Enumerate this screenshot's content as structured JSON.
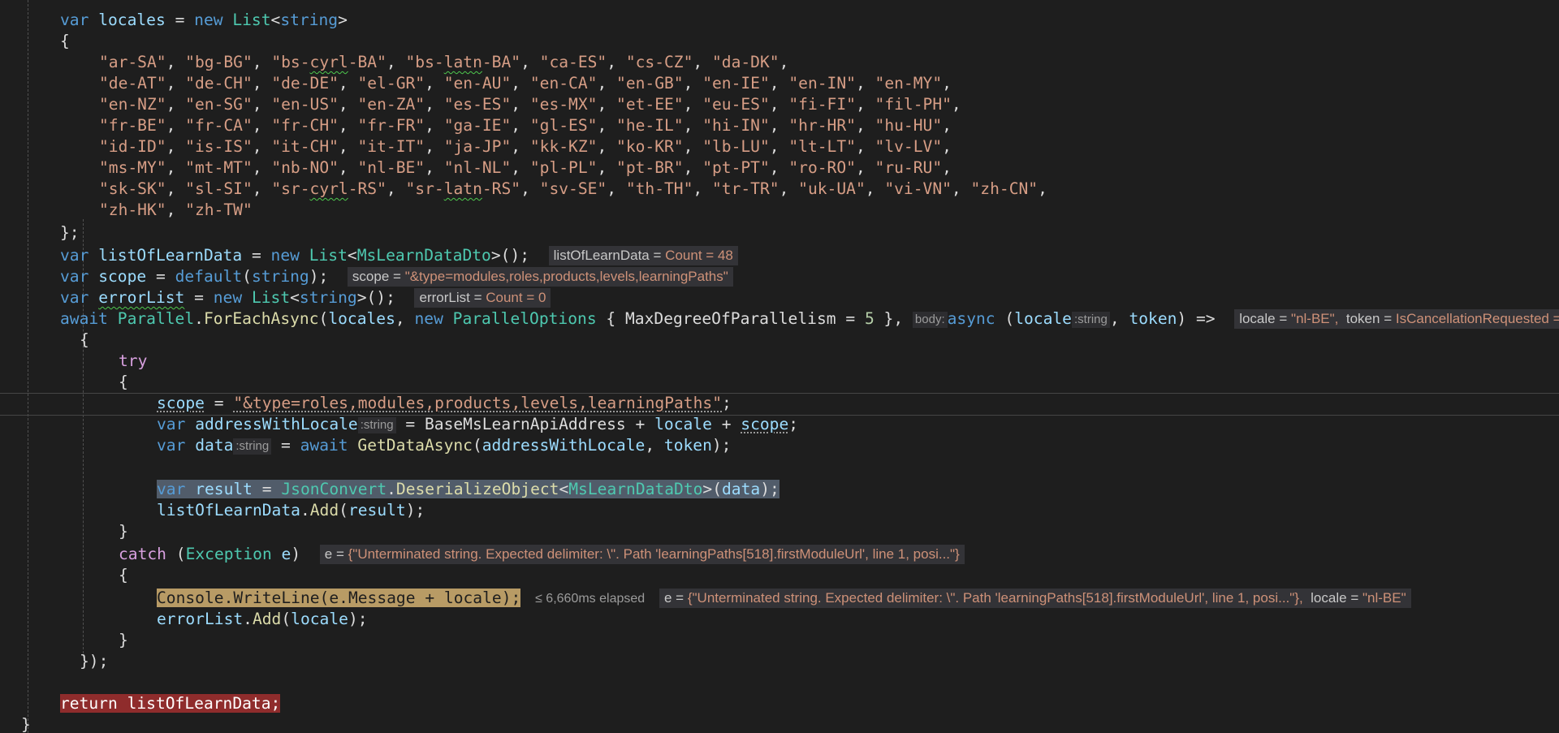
{
  "code": {
    "locales_decl": {
      "kw_var": "var",
      "name": "locales",
      "op": "=",
      "kw_new": "new",
      "type": "List",
      "generic_open": "<",
      "generic_type": "string",
      "generic_close": ">"
    },
    "open_brace": "{",
    "locale_rows": [
      [
        "\"ar-SA\"",
        "\"bg-BG\"",
        "\"bs-cyrl-BA\"",
        "\"bs-latn-BA\"",
        "\"ca-ES\"",
        "\"cs-CZ\"",
        "\"da-DK\""
      ],
      [
        "\"de-AT\"",
        "\"de-CH\"",
        "\"de-DE\"",
        "\"el-GR\"",
        "\"en-AU\"",
        "\"en-CA\"",
        "\"en-GB\"",
        "\"en-IE\"",
        "\"en-IN\"",
        "\"en-MY\""
      ],
      [
        "\"en-NZ\"",
        "\"en-SG\"",
        "\"en-US\"",
        "\"en-ZA\"",
        "\"es-ES\"",
        "\"es-MX\"",
        "\"et-EE\"",
        "\"eu-ES\"",
        "\"fi-FI\"",
        "\"fil-PH\""
      ],
      [
        "\"fr-BE\"",
        "\"fr-CA\"",
        "\"fr-CH\"",
        "\"fr-FR\"",
        "\"ga-IE\"",
        "\"gl-ES\"",
        "\"he-IL\"",
        "\"hi-IN\"",
        "\"hr-HR\"",
        "\"hu-HU\""
      ],
      [
        "\"id-ID\"",
        "\"is-IS\"",
        "\"it-CH\"",
        "\"it-IT\"",
        "\"ja-JP\"",
        "\"kk-KZ\"",
        "\"ko-KR\"",
        "\"lb-LU\"",
        "\"lt-LT\"",
        "\"lv-LV\""
      ],
      [
        "\"ms-MY\"",
        "\"mt-MT\"",
        "\"nb-NO\"",
        "\"nl-BE\"",
        "\"nl-NL\"",
        "\"pl-PL\"",
        "\"pt-BR\"",
        "\"pt-PT\"",
        "\"ro-RO\"",
        "\"ru-RU\""
      ],
      [
        "\"sk-SK\"",
        "\"sl-SI\"",
        "\"sr-cyrl-RS\"",
        "\"sr-latn-RS\"",
        "\"sv-SE\"",
        "\"th-TH\"",
        "\"tr-TR\"",
        "\"uk-UA\"",
        "\"vi-VN\"",
        "\"zh-CN\""
      ],
      [
        "\"zh-HK\"",
        "\"zh-TW\""
      ]
    ],
    "close_brace_semi": "};",
    "learn_decl": {
      "kw_var": "var",
      "name": "listOfLearnData",
      "op": "=",
      "kw_new": "new",
      "type": "List",
      "lt": "<",
      "generic_type": "MsLearnDataDto",
      "tail": ">();"
    },
    "learn_tip": {
      "name": "listOfLearnData",
      "eq": "=",
      "value": "Count = 48"
    },
    "scope_decl": {
      "kw_var": "var",
      "name": "scope",
      "op": "=",
      "kw_default": "default",
      "paren_open": "(",
      "kw_string": "string",
      "tail": ");"
    },
    "scope_tip": {
      "name": "scope",
      "eq": "=",
      "value": "\"&type=modules,roles,products,levels,learningPaths\""
    },
    "error_decl": {
      "kw_var": "var",
      "name": "errorList",
      "op": "=",
      "kw_new": "new",
      "type": "List",
      "generic_open": "<",
      "generic_type": "string",
      "tail": ">();"
    },
    "error_tip": {
      "name": "errorList",
      "eq": "=",
      "value": "Count = 0"
    },
    "await_line": {
      "kw_await": "await",
      "type_parallel": "Parallel",
      "dot": ".",
      "method": "ForEachAsync",
      "paren_open": "(",
      "arg_locales": "locales",
      "comma": ",",
      "kw_new": "new",
      "type_options": "ParallelOptions",
      "brace_open": "{",
      "prop": "MaxDegreeOfParallelism",
      "eq": "=",
      "num": "5",
      "brace_close": "},",
      "hint_body": "body:",
      "kw_async": "async",
      "paren2_open": "(",
      "param_locale": "locale",
      "hint_string": ":string",
      "comma2": ",",
      "param_token": "token",
      "arrow": ") =>"
    },
    "await_tip": {
      "locale_name": "locale",
      "eq": "=",
      "locale_value": "\"nl-BE\",",
      "token_name": "token",
      "token_value": "IsCancellationRequested = false"
    },
    "lambda_open": "{",
    "kw_try": "try",
    "try_open": "{",
    "scope_assign": {
      "name": "scope",
      "op": "=",
      "value": "\"&type=roles,modules,products,levels,learningPaths\"",
      "semi": ";"
    },
    "address_decl": {
      "kw_var": "var",
      "name": "addressWithLocale",
      "hint": ":string",
      "op": "=",
      "base": "BaseMsLearnApiAddress",
      "plus1": "+",
      "locale": "locale",
      "plus2": "+",
      "scope": "scope",
      "semi": ";"
    },
    "data_decl": {
      "kw_var": "var",
      "name": "data",
      "hint": ":string",
      "op": "=",
      "kw_await": "await",
      "method": "GetDataAsync",
      "paren": "(",
      "arg1": "addressWithLocale",
      "comma": ",",
      "arg2": "token",
      "tail": ");"
    },
    "result_decl": {
      "kw_var": "var",
      "name": "result",
      "op": "=",
      "type_json": "JsonConvert",
      "dot": ".",
      "method": "DeserializeObject",
      "lt": "<",
      "type_dto": "MsLearnDataDto",
      "gt_paren": ">(",
      "arg": "data",
      "tail": ");"
    },
    "add_result": {
      "list": "listOfLearnData",
      "dot": ".",
      "method": "Add",
      "paren": "(",
      "arg": "result",
      "tail": ");"
    },
    "try_close": "}",
    "catch_line": {
      "kw_catch": "catch",
      "paren_open": "(",
      "type_exception": "Exception",
      "param": "e",
      "paren_close": ")"
    },
    "catch_tip": {
      "name": "e",
      "eq": "=",
      "value": "{\"Unterminated string. Expected delimiter: \\\". Path 'learningPaths[518].firstModuleUrl', line 1, posi...\"}"
    },
    "catch_open": "{",
    "console_line": {
      "type_console": "Console",
      "dot1": ".",
      "method": "WriteLine",
      "paren": "(",
      "arg_e": "e",
      "dot2": ".",
      "prop": "Message",
      "plus": "+",
      "arg_locale": "locale",
      "tail": ");"
    },
    "elapsed": "≤ 6,660ms elapsed",
    "console_tip": {
      "e_name": "e",
      "eq": "=",
      "e_value": "{\"Unterminated string. Expected delimiter: \\\". Path 'learningPaths[518].firstModuleUrl', line 1, posi...\"},",
      "locale_name": "locale",
      "locale_value": "\"nl-BE\""
    },
    "errorlist_add": {
      "list": "errorList",
      "dot": ".",
      "method": "Add",
      "paren": "(",
      "arg": "locale",
      "tail": ");"
    },
    "catch_close": "}",
    "lambda_close": "});",
    "return_line": {
      "kw_return": "return",
      "value": "listOfLearnData;"
    },
    "method_close": "}"
  },
  "colors": {
    "background": "#1e1e1e",
    "keyword": "#569cd6",
    "control_keyword": "#d8a0df",
    "string": "#d69d85",
    "type": "#4ec9b0",
    "method": "#dcdcaa",
    "variable": "#9cdcfe",
    "number": "#b5cea8",
    "execution_highlight": "#b89b65",
    "return_highlight": "#8f2c2c",
    "selection": "#515c6a"
  }
}
